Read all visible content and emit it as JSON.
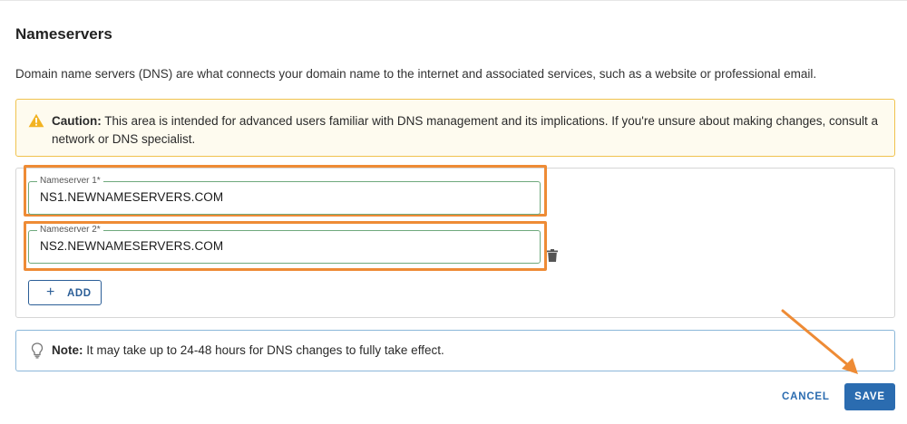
{
  "section": {
    "title": "Nameservers",
    "description": "Domain name servers (DNS) are what connects your domain name to the internet and associated services, such as a website or professional email."
  },
  "caution": {
    "label": "Caution:",
    "text": " This area is intended for advanced users familiar with DNS management and its implications. If you're unsure about making changes, consult a network or DNS specialist.",
    "icon": "warning-icon",
    "color": "#f0c34f"
  },
  "nameservers": [
    {
      "label": "Nameserver 1*",
      "value": "NS1.NEWNAMESERVERS.COM"
    },
    {
      "label": "Nameserver 2*",
      "value": "NS2.NEWNAMESERVERS.COM"
    }
  ],
  "add_button": {
    "icon": "plus-icon",
    "label": "ADD"
  },
  "note": {
    "label": "Note:",
    "text": " It may take up to 24-48 hours for DNS changes to fully take effect.",
    "icon": "lightbulb-icon"
  },
  "actions": {
    "cancel": "CANCEL",
    "save": "SAVE"
  },
  "colors": {
    "primary": "#2b6cb0",
    "highlight": "#ee8b35",
    "field_border": "#6fa97d",
    "note_border": "#8bb7d9"
  }
}
